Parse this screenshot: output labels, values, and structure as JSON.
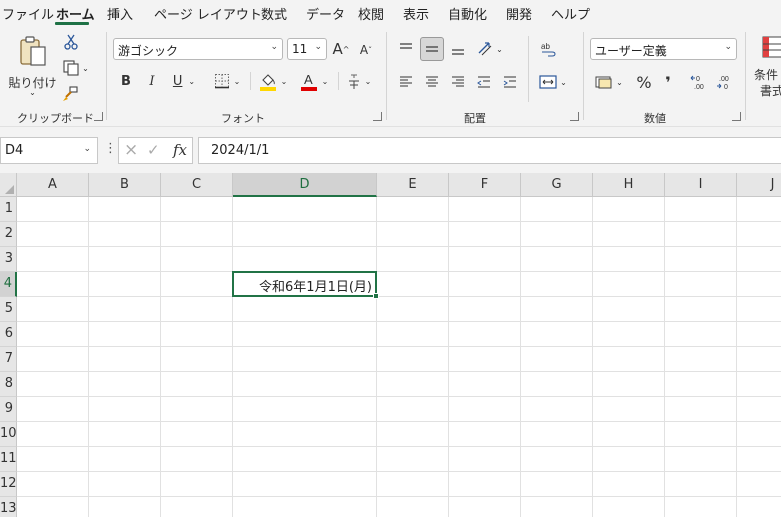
{
  "menu_tabs": [
    "ファイル",
    "ホーム",
    "挿入",
    "ページ レイアウト",
    "数式",
    "データ",
    "校閲",
    "表示",
    "自動化",
    "開発",
    "ヘルプ"
  ],
  "active_tab": "ホーム",
  "ribbon": {
    "clipboard": {
      "paste_label": "貼り付け",
      "group_label": "クリップボード"
    },
    "font": {
      "font_name": "游ゴシック",
      "font_size": "11",
      "grow_label": "A",
      "shrink_label": "A",
      "bold": "B",
      "italic": "I",
      "underline": "U",
      "font_color_letter": "A",
      "highlight_color": "#ffd700",
      "font_color": "#e00000",
      "group_label": "フォント"
    },
    "alignment": {
      "group_label": "配置"
    },
    "number": {
      "format": "ユーザー定義",
      "percent": "%",
      "comma": "❜",
      "group_label": "数値"
    },
    "styles": {
      "cond_format_label_1": "条件",
      "cond_format_label_2": "書式"
    }
  },
  "formula_bar": {
    "name_box": "D4",
    "cancel_icon": "×",
    "enter_icon": "✓",
    "fx_label": "fx",
    "formula": "2024/1/1"
  },
  "sheet": {
    "columns": [
      "A",
      "B",
      "C",
      "D",
      "E",
      "F",
      "G",
      "H",
      "I",
      "J"
    ],
    "rows": [
      "1",
      "2",
      "3",
      "4",
      "5",
      "6",
      "7",
      "8",
      "9",
      "10",
      "11",
      "12",
      "13"
    ],
    "selected_column": "D",
    "selected_row": "4",
    "active_cell_value": "令和6年1月1日(月)"
  },
  "colors": {
    "accent": "#217346",
    "accent_dark": "#1e7145"
  }
}
